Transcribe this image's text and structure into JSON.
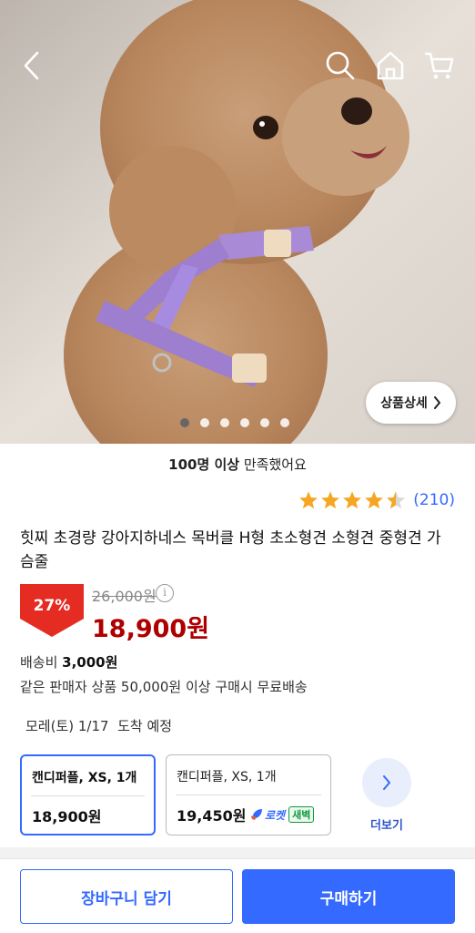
{
  "hero": {
    "detail_button_label": "상품상세",
    "slides_total": 6,
    "slide_active": 1,
    "icons": [
      "back-icon",
      "search-icon",
      "home-icon",
      "cart-icon"
    ]
  },
  "summary": {
    "satisfied_bold": "100명 이상",
    "satisfied_rest": " 만족했어요",
    "rating_stars": 4.5,
    "rating_count": "(210)"
  },
  "product": {
    "title": "힛찌 초경량 강아지하네스 목버클 H형 초소형견 소형견 중형견 가슴줄",
    "discount": "27%",
    "original_price": "26,000원",
    "sale_price": "18,900원"
  },
  "shipping": {
    "fee_label": "배송비 ",
    "fee_value": "3,000원",
    "free_condition": "같은 판매자 상품 50,000원 이상 구매시 무료배송",
    "arrival": "모레(토) 1/17  도착 예정"
  },
  "options": [
    {
      "name": "캔디퍼플, XS, 1개",
      "price": "18,900원",
      "selected": true
    },
    {
      "name": "캔디퍼플, XS, 1개",
      "price": "19,450원",
      "selected": false,
      "rocket_label": "로켓",
      "dawn_label": "새벽"
    }
  ],
  "more_label": "더보기",
  "actions": {
    "cart_label": "장바구니 담기",
    "buy_label": "구매하기"
  },
  "colors": {
    "accent": "#346aff",
    "price_red": "#ae0000",
    "badge_red": "#e52c22",
    "star": "#f5a623"
  }
}
